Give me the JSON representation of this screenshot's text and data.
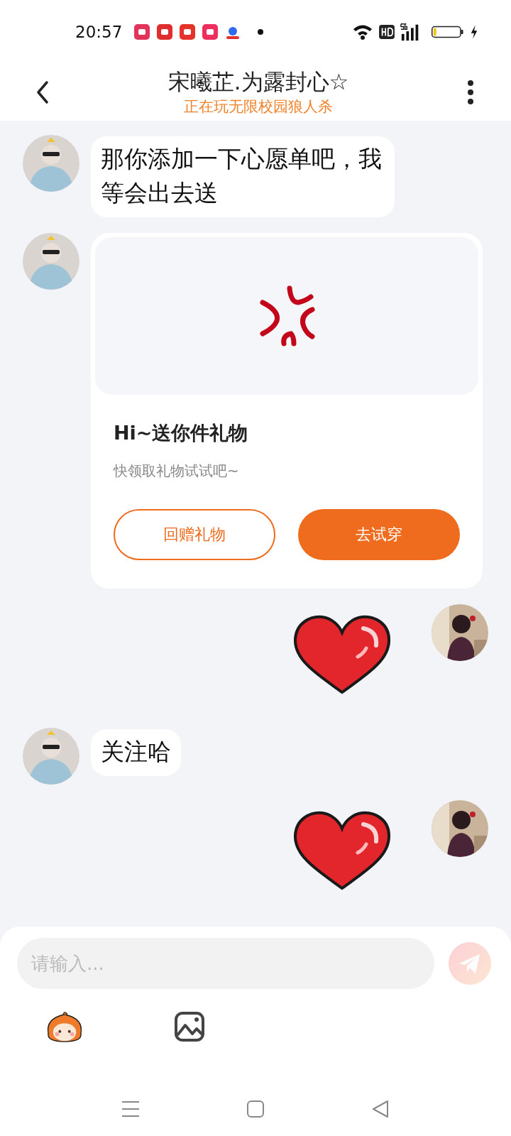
{
  "status_bar": {
    "time": "20:57"
  },
  "header": {
    "title": "宋曦芷.为露封心☆",
    "subtitle": "正在玩无限校园狼人杀"
  },
  "messages": [
    {
      "outgoing": false,
      "kind": "text",
      "text": "那你添加一下心愿单吧，我等会出去送"
    },
    {
      "outgoing": false,
      "kind": "gift_card",
      "title": "Hi~送你件礼物",
      "description": "快领取礼物试试吧~",
      "buttons": [
        {
          "label": "回赠礼物",
          "kind": "outline"
        },
        {
          "label": "去试穿",
          "kind": "filled"
        }
      ]
    },
    {
      "outgoing": true,
      "kind": "sticker"
    },
    {
      "outgoing": false,
      "kind": "text",
      "text": "关注哈"
    },
    {
      "outgoing": true,
      "kind": "sticker"
    }
  ],
  "composer": {
    "placeholder": "请输入..."
  }
}
